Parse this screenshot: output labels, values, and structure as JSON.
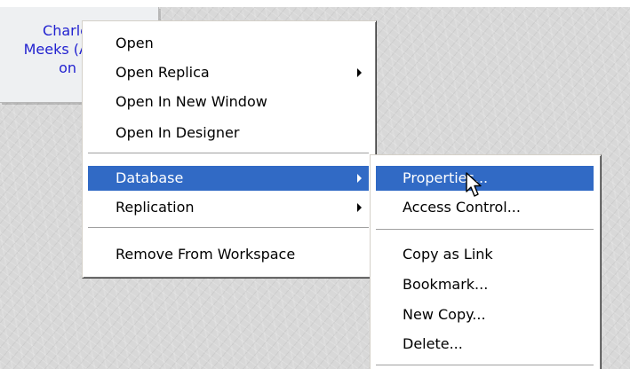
{
  "workspace_tile": {
    "lines": [
      "Charle",
      "Meeks (A",
      "on L"
    ]
  },
  "context_menu": {
    "items": [
      {
        "label": "Open"
      },
      {
        "label": "Open Replica"
      },
      {
        "label": "Open In New Window"
      },
      {
        "label": "Open In Designer"
      },
      {
        "label": "Database"
      },
      {
        "label": "Replication"
      },
      {
        "label": "Remove From Workspace"
      }
    ],
    "selected": "Database"
  },
  "submenu": {
    "items": [
      {
        "label": "Properties..."
      },
      {
        "label": "Access Control..."
      },
      {
        "label": "Copy as Link"
      },
      {
        "label": "Bookmark..."
      },
      {
        "label": "New Copy..."
      },
      {
        "label": "Delete..."
      }
    ],
    "selected": "Properties..."
  },
  "colors": {
    "selection": "#316ac5",
    "tile_text": "#2222d0"
  }
}
